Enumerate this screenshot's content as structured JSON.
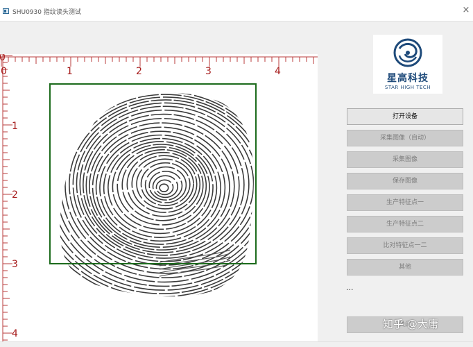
{
  "window": {
    "title": "SHU0930 指纹读头测试",
    "close_glyph": "×"
  },
  "ruler": {
    "top_labels": [
      "0",
      "1",
      "2",
      "3",
      "4"
    ],
    "left_labels": [
      "1",
      "2",
      "3",
      "4"
    ],
    "color": "#a61c1c"
  },
  "logo": {
    "name": "星高科技",
    "subtitle": "STAR HIGH TECH",
    "color": "#1e4a7a"
  },
  "buttons": [
    {
      "label": "打开设备",
      "enabled": true
    },
    {
      "label": "采集图像（自动）",
      "enabled": false
    },
    {
      "label": "采集图像",
      "enabled": false
    },
    {
      "label": "保存图像",
      "enabled": false
    },
    {
      "label": "生产特征点一",
      "enabled": false
    },
    {
      "label": "生产特征点二",
      "enabled": false
    },
    {
      "label": "比对特征点一二",
      "enabled": false
    },
    {
      "label": "其他",
      "enabled": false
    }
  ],
  "status_text": "...",
  "close_button_label": "关闭",
  "watermark": "知乎 @大庸",
  "colors": {
    "capture_box": "#1c6b1c"
  }
}
